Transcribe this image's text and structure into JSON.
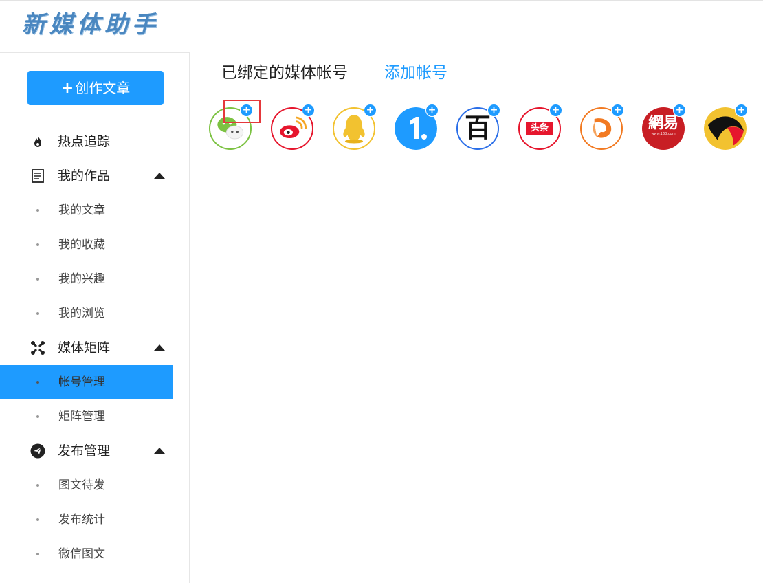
{
  "app": {
    "logo": "新媒体助手"
  },
  "sidebar": {
    "create_button": {
      "plus": "+",
      "label": "创作文章"
    },
    "items": [
      {
        "label": "热点追踪",
        "icon": "flame-icon"
      },
      {
        "label": "我的作品",
        "icon": "document-list-icon",
        "expanded": true,
        "children": [
          "我的文章",
          "我的收藏",
          "我的兴趣",
          "我的浏览"
        ]
      },
      {
        "label": "媒体矩阵",
        "icon": "joomla-network-icon",
        "expanded": true,
        "children": [
          "帐号管理",
          "矩阵管理"
        ],
        "active_child": "帐号管理"
      },
      {
        "label": "发布管理",
        "icon": "paper-plane-icon",
        "expanded": true,
        "children": [
          "图文待发",
          "发布统计",
          "微信图文"
        ]
      }
    ]
  },
  "main": {
    "tabs": {
      "bound": "已绑定的媒体帐号",
      "add": "添加帐号"
    },
    "platforms": [
      {
        "id": "wechat",
        "icon": "wechat-icon",
        "border": "#7cc242"
      },
      {
        "id": "weibo",
        "icon": "weibo-icon",
        "border": "#e6162d"
      },
      {
        "id": "qq",
        "icon": "qq-penguin-icon",
        "border": "#f2c230"
      },
      {
        "id": "yidian",
        "icon": "yidian-icon",
        "border": "#1e9bff"
      },
      {
        "id": "baijia",
        "icon": "baijiahao-icon",
        "border": "#2a6ee8",
        "glyph": "百"
      },
      {
        "id": "toutiao",
        "icon": "toutiao-icon",
        "border": "#e6162d",
        "glyph": "头条"
      },
      {
        "id": "dayu",
        "icon": "dayu-fish-icon",
        "border": "#f27a22"
      },
      {
        "id": "netease",
        "icon": "netease-icon",
        "border": "#c81e24",
        "glyph": "網易",
        "subtext": "www.163.com"
      },
      {
        "id": "sohu",
        "icon": "sohu-icon",
        "border": "#f2c230"
      }
    ],
    "badge": "+"
  },
  "colors": {
    "accent": "#1e9bff",
    "highlight": "#e5383b"
  }
}
